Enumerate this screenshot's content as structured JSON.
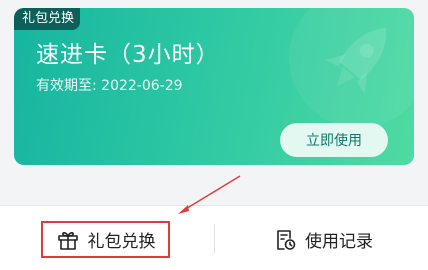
{
  "card": {
    "tag": "礼包兑换",
    "title": "速进卡（3小时）",
    "expiry": "有效期至: 2022-06-29",
    "use_label": "立即使用"
  },
  "bottom_bar": {
    "redeem_label": "礼包兑换",
    "history_label": "使用记录"
  },
  "icons": {
    "gift": "gift-icon",
    "history": "record-history-icon",
    "rocket": "rocket-decoration-icon"
  },
  "colors": {
    "card_gradient_start": "#16b5a0",
    "card_gradient_end": "#4fdaa3",
    "tag_bg": "#0d5f59",
    "button_bg": "#e3f8f1",
    "button_text": "#0f7a6c",
    "highlight_red": "#e33b3b"
  }
}
